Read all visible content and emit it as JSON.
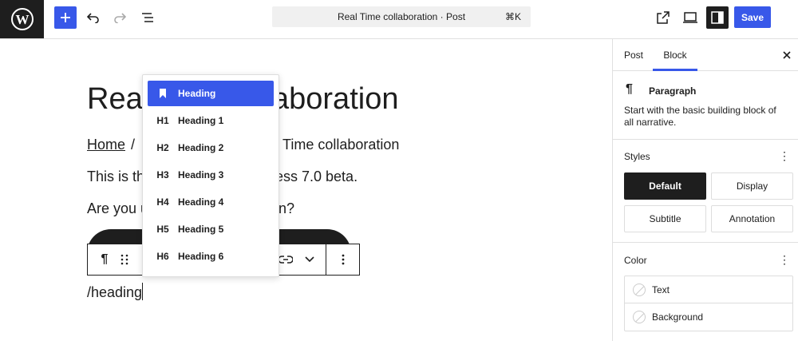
{
  "topbar": {
    "command_label": "Real Time collaboration · Post",
    "command_shortcut": "⌘K",
    "save_label": "Save"
  },
  "canvas": {
    "title_left": "Real",
    "title_right": "aboration",
    "breadcrumb_home": "Home",
    "breadcrumb_sep": "/",
    "breadcrumb_tail": "Time collaboration",
    "para1_start": "This is th",
    "para1_end": "ess 7.0 beta.",
    "para2_start": "Are you u",
    "para2_end": "in?",
    "slash_command": "/heading"
  },
  "dropdown": {
    "items": [
      {
        "icon": "",
        "label": "Heading"
      },
      {
        "icon": "H1",
        "label": "Heading 1"
      },
      {
        "icon": "H2",
        "label": "Heading 2"
      },
      {
        "icon": "H3",
        "label": "Heading 3"
      },
      {
        "icon": "H4",
        "label": "Heading 4"
      },
      {
        "icon": "H5",
        "label": "Heading 5"
      },
      {
        "icon": "H6",
        "label": "Heading 6"
      }
    ],
    "active_index": 0
  },
  "sidebar": {
    "tabs": [
      {
        "label": "Post"
      },
      {
        "label": "Block"
      }
    ],
    "active_tab": "Block",
    "block_name": "Paragraph",
    "block_description": "Start with the basic building block of all narrative.",
    "styles_title": "Styles",
    "styles": [
      {
        "label": "Default"
      },
      {
        "label": "Display"
      },
      {
        "label": "Subtitle"
      },
      {
        "label": "Annotation"
      }
    ],
    "color_title": "Color",
    "color_items": [
      {
        "label": "Text"
      },
      {
        "label": "Background"
      }
    ]
  },
  "colors": {
    "accent": "#3858e9",
    "dark": "#1e1e1e"
  }
}
